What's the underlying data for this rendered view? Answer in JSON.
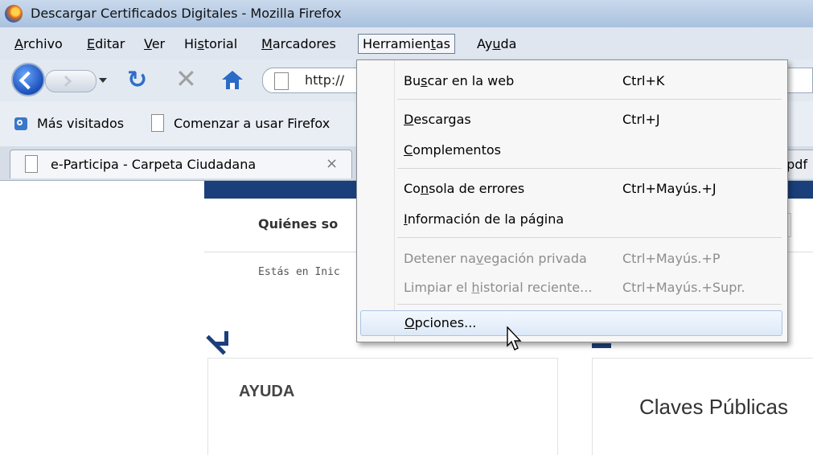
{
  "window": {
    "title": "Descargar Certificados Digitales - Mozilla Firefox"
  },
  "menubar": {
    "items": [
      {
        "pre": "",
        "key": "A",
        "post": "rchivo"
      },
      {
        "pre": "",
        "key": "E",
        "post": "ditar"
      },
      {
        "pre": "",
        "key": "V",
        "post": "er"
      },
      {
        "pre": "Hi",
        "key": "s",
        "post": "torial"
      },
      {
        "pre": "",
        "key": "M",
        "post": "arcadores"
      },
      {
        "pre": "Herramien",
        "key": "t",
        "post": "as"
      },
      {
        "pre": "Ay",
        "key": "u",
        "post": "da"
      }
    ]
  },
  "navbar": {
    "url": "http://"
  },
  "bookmarks": {
    "most_visited": "Más visitados",
    "getting_started": "Comenzar a usar Firefox"
  },
  "tabs": {
    "active_label": "e-Participa - Carpeta Ciudadana",
    "close_glyph": "×",
    "second_label": ".pdf"
  },
  "page": {
    "nav_text": "Quiénes so",
    "breadcrumb": "Estás en Inic",
    "left_panel_title": "AYUDA",
    "right_panel_title": "Claves Públicas"
  },
  "dropdown": {
    "search_pre": "Bu",
    "search_key": "s",
    "search_post": "car en la web",
    "search_shortcut": "Ctrl+K",
    "downloads_key": "D",
    "downloads_post": "escargas",
    "downloads_shortcut": "Ctrl+J",
    "addons_key": "C",
    "addons_post": "omplementos",
    "console_pre": "Co",
    "console_key": "n",
    "console_post": "sola de errores",
    "console_shortcut": "Ctrl+Mayús.+J",
    "pageinfo_key": "I",
    "pageinfo_post": "nformación de la página",
    "private_pre": "Detener na",
    "private_key": "v",
    "private_post": "egación privada",
    "private_shortcut": "Ctrl+Mayús.+P",
    "clear_pre": "Limpiar el ",
    "clear_key": "h",
    "clear_post": "istorial reciente...",
    "clear_shortcut": "Ctrl+Mayús.+Supr.",
    "options_key": "O",
    "options_post": "pciones..."
  }
}
